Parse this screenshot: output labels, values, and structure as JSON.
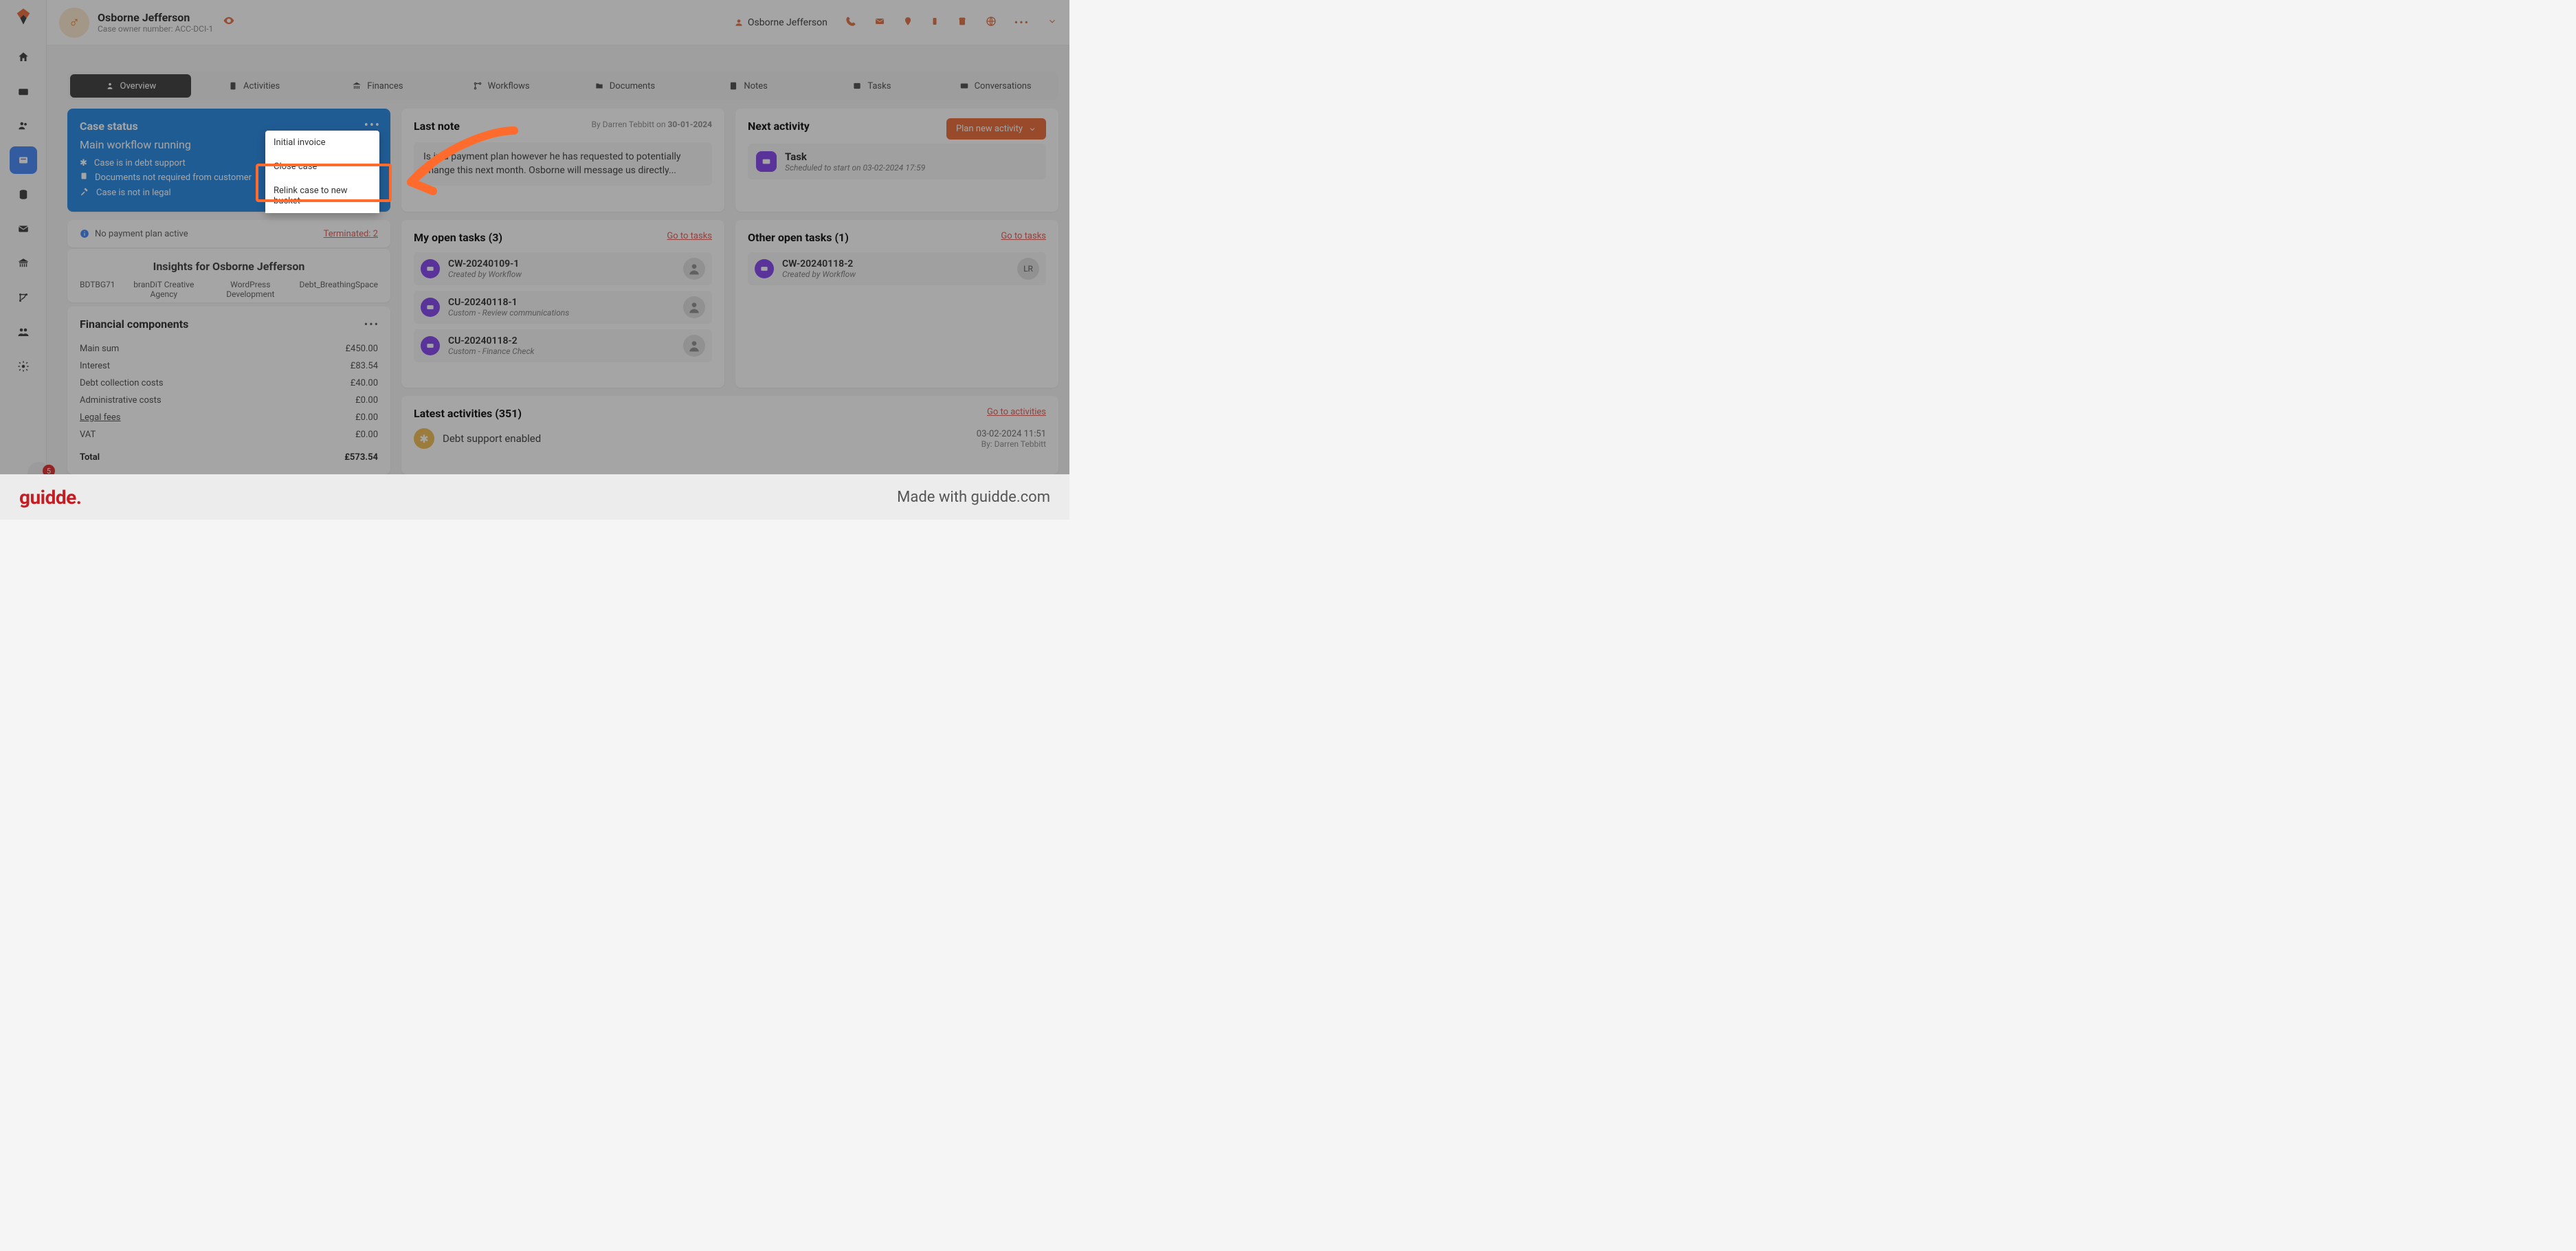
{
  "header": {
    "name": "Osborne Jefferson",
    "sub": "Case owner number: ACC-DCI-1",
    "user": "Osborne Jefferson"
  },
  "notif": "5",
  "tabs": [
    "Overview",
    "Activities",
    "Finances",
    "Workflows",
    "Documents",
    "Notes",
    "Tasks",
    "Conversations"
  ],
  "caseStatus": {
    "title": "Case status",
    "workflow": "Main workflow running",
    "lines": [
      "Case is in debt support",
      "Documents not required from customer",
      "Case is not in legal"
    ]
  },
  "dropdown": {
    "opt1": "Initial invoice",
    "opt2": "Close case",
    "opt3": "Relink case to new bucket"
  },
  "paywarn": {
    "text": "No payment plan active",
    "term": "Terminated: 2"
  },
  "insights": {
    "title": "Insights for Osborne Jefferson",
    "tags": [
      "BDTBG71",
      "branDiT Creative Agency",
      "WordPress Development",
      "Debt_BreathingSpace"
    ]
  },
  "fin": {
    "title": "Financial components",
    "rows": [
      {
        "label": "Main sum",
        "val": "£450.00"
      },
      {
        "label": "Interest",
        "val": "£83.54"
      },
      {
        "label": "Debt collection costs",
        "val": "£40.00"
      },
      {
        "label": "Administrative costs",
        "val": "£0.00"
      },
      {
        "label": "Legal fees",
        "val": "£0.00",
        "u": true
      },
      {
        "label": "VAT",
        "val": "£0.00"
      }
    ],
    "total": {
      "label": "Total",
      "val": "£573.54"
    }
  },
  "lastnote": {
    "title": "Last note",
    "by_prefix": "By Darren Tebbitt on ",
    "by_date": "30-01-2024",
    "text": "Is in a payment plan however he has requested to potentially change this next month. Osborne will message us directly..."
  },
  "nextact": {
    "title": "Next activity",
    "btn": "Plan new activity",
    "task": "Task",
    "sub": "Scheduled to start on 03-02-2024 17:59"
  },
  "mytasks": {
    "title": "My open tasks (3)",
    "goto": "Go to tasks",
    "items": [
      {
        "name": "CW-20240109-1",
        "sub": "Created by Workflow"
      },
      {
        "name": "CU-20240118-1",
        "sub": "Custom - Review communications"
      },
      {
        "name": "CU-20240118-2",
        "sub": "Custom - Finance Check"
      }
    ]
  },
  "othertasks": {
    "title": "Other open tasks (1)",
    "goto": "Go to tasks",
    "items": [
      {
        "name": "CW-20240118-2",
        "sub": "Created by Workflow",
        "ava": "LR"
      }
    ]
  },
  "latest": {
    "title": "Latest activities (351)",
    "goto": "Go to activities",
    "name": "Debt support enabled",
    "time": "03-02-2024 11:51",
    "by": "By: Darren Tebbitt"
  },
  "footer": {
    "logo": "guidde.",
    "made": "Made with guidde.com"
  }
}
